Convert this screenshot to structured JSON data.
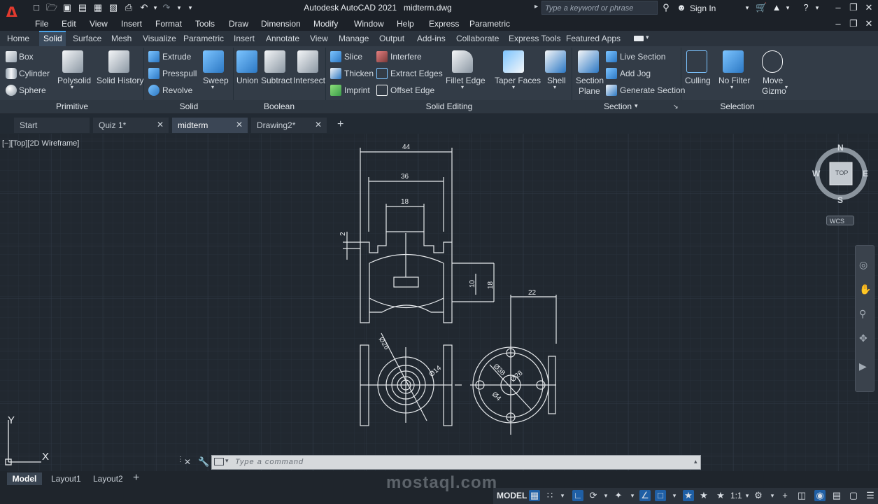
{
  "title_bar": {
    "app_title": "Autodesk AutoCAD 2021",
    "file_name": "midterm.dwg",
    "search_placeholder": "Type a keyword or phrase",
    "sign_in": "Sign In",
    "app_logo": "A"
  },
  "menu": [
    "File",
    "Edit",
    "View",
    "Insert",
    "Format",
    "Tools",
    "Draw",
    "Dimension",
    "Modify",
    "Window",
    "Help",
    "Express",
    "Parametric"
  ],
  "ribbon_tabs": [
    "Home",
    "Solid",
    "Surface",
    "Mesh",
    "Visualize",
    "Parametric",
    "Insert",
    "Annotate",
    "View",
    "Manage",
    "Output",
    "Add-ins",
    "Collaborate",
    "Express Tools",
    "Featured Apps"
  ],
  "ribbon_active_tab": "Solid",
  "ribbon": {
    "primitive": {
      "title": "Primitive",
      "small": [
        "Box",
        "Cylinder",
        "Sphere"
      ],
      "big": [
        "Polysolid",
        "Solid History"
      ]
    },
    "solid": {
      "title": "Solid",
      "small": [
        "Extrude",
        "Presspull",
        "Revolve"
      ],
      "big": [
        "Sweep"
      ]
    },
    "boolean": {
      "title": "Boolean",
      "big": [
        "Union",
        "Subtract",
        "Intersect"
      ]
    },
    "solid_editing": {
      "title": "Solid Editing",
      "small1": [
        "Slice",
        "Thicken",
        "Imprint"
      ],
      "small2": [
        "Interfere",
        "Extract Edges",
        "Offset Edge"
      ],
      "big": [
        "Fillet Edge",
        "Taper Faces",
        "Shell"
      ]
    },
    "section": {
      "title": "Section",
      "big": [
        "Section",
        "Plane"
      ],
      "small": [
        "Live Section",
        "Add Jog",
        "Generate Section"
      ]
    },
    "selection": {
      "title": "Selection",
      "big": [
        "Culling",
        "No Filter",
        "Move",
        "Gizmo"
      ]
    }
  },
  "doc_tabs": [
    {
      "label": "Start",
      "closable": false
    },
    {
      "label": "Quiz 1*",
      "closable": true
    },
    {
      "label": "midterm",
      "closable": true,
      "active": true
    },
    {
      "label": "Drawing2*",
      "closable": true
    }
  ],
  "viewport_label": "[−][Top][2D Wireframe]",
  "viewcube": {
    "top": "TOP",
    "n": "N",
    "s": "S",
    "e": "E",
    "w": "W",
    "wcs": "WCS"
  },
  "ucs": {
    "x": "X",
    "y": "Y"
  },
  "drawing": {
    "dims": [
      "44",
      "36",
      "18",
      "2",
      "10",
      "18",
      "22"
    ],
    "diameters": [
      "Ø26",
      "Ø14",
      "Ø38",
      "Ø28",
      "Ø4"
    ]
  },
  "command": {
    "placeholder": "Type a command"
  },
  "layout_tabs": [
    "Model",
    "Layout1",
    "Layout2"
  ],
  "status": {
    "model": "MODEL",
    "scale": "1:1"
  },
  "watermark": "mostaql.com",
  "colors": {
    "accent": "#4aa3e8",
    "logo": "#e23a2e",
    "canvas": "#212830",
    "ribbon": "#333c47"
  }
}
